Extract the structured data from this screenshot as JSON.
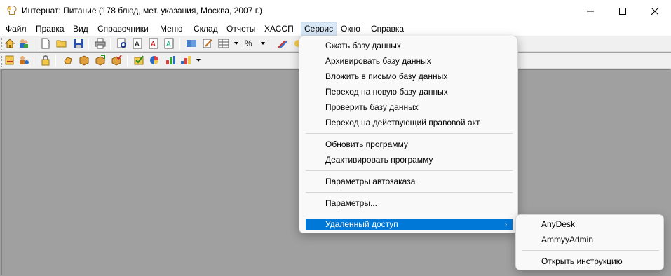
{
  "window": {
    "title": "Интернат: Питание (178 блюд, мет. указания, Москва, 2007 г.)"
  },
  "menubar": {
    "items": [
      "Файл",
      "Правка",
      "Вид",
      "Справочники",
      "Меню",
      "Склад",
      "Отчеты",
      "ХАССП",
      "Сервис",
      "Окно",
      "Справка"
    ],
    "active": "Сервис"
  },
  "service_menu": {
    "items": [
      "Сжать базу данных",
      "Архивировать базу данных",
      "Вложить в письмо базу данных",
      "Переход на новую базу данных",
      "Проверить базу данных",
      "Переход на действующий правовой акт",
      "Обновить программу",
      "Деактивировать программу",
      "Параметры автозаказа",
      "Параметры...",
      "Удаленный доступ"
    ],
    "submenu_arrow": "›"
  },
  "remote_submenu": {
    "items": [
      "AnyDesk",
      "AmmyyAdmin",
      "Открыть инструкцию"
    ]
  },
  "toolbar1": {
    "percent_label": "%"
  },
  "colors": {
    "selection": "#0078d7",
    "workspace": "#a0a0a0",
    "menu_background": "#f9f9f9"
  }
}
